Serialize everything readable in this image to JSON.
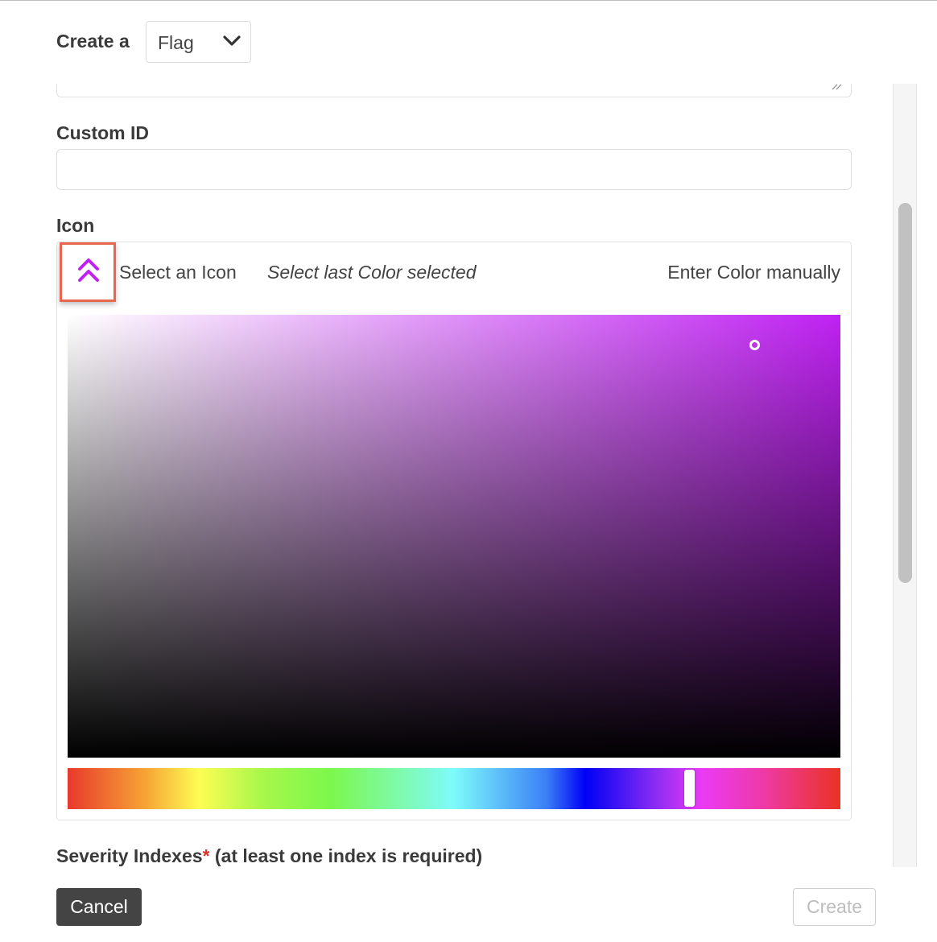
{
  "header": {
    "create_label": "Create a",
    "type_select_value": "Flag"
  },
  "form": {
    "custom_id_label": "Custom ID",
    "custom_id_value": "",
    "icon_label": "Icon",
    "icon_picker": {
      "select_icon_label": "Select an Icon",
      "last_color_label": "Select last Color selected",
      "manual_color_label": "Enter Color manually",
      "selected_icon": "double-chevron-up-icon",
      "icon_color": "#c022f3",
      "hue_position": 0.8
    },
    "severity_label": "Severity Indexes",
    "severity_required_mark": "*",
    "severity_note": " (at least one index is required)"
  },
  "footer": {
    "cancel_label": "Cancel",
    "create_label": "Create"
  }
}
